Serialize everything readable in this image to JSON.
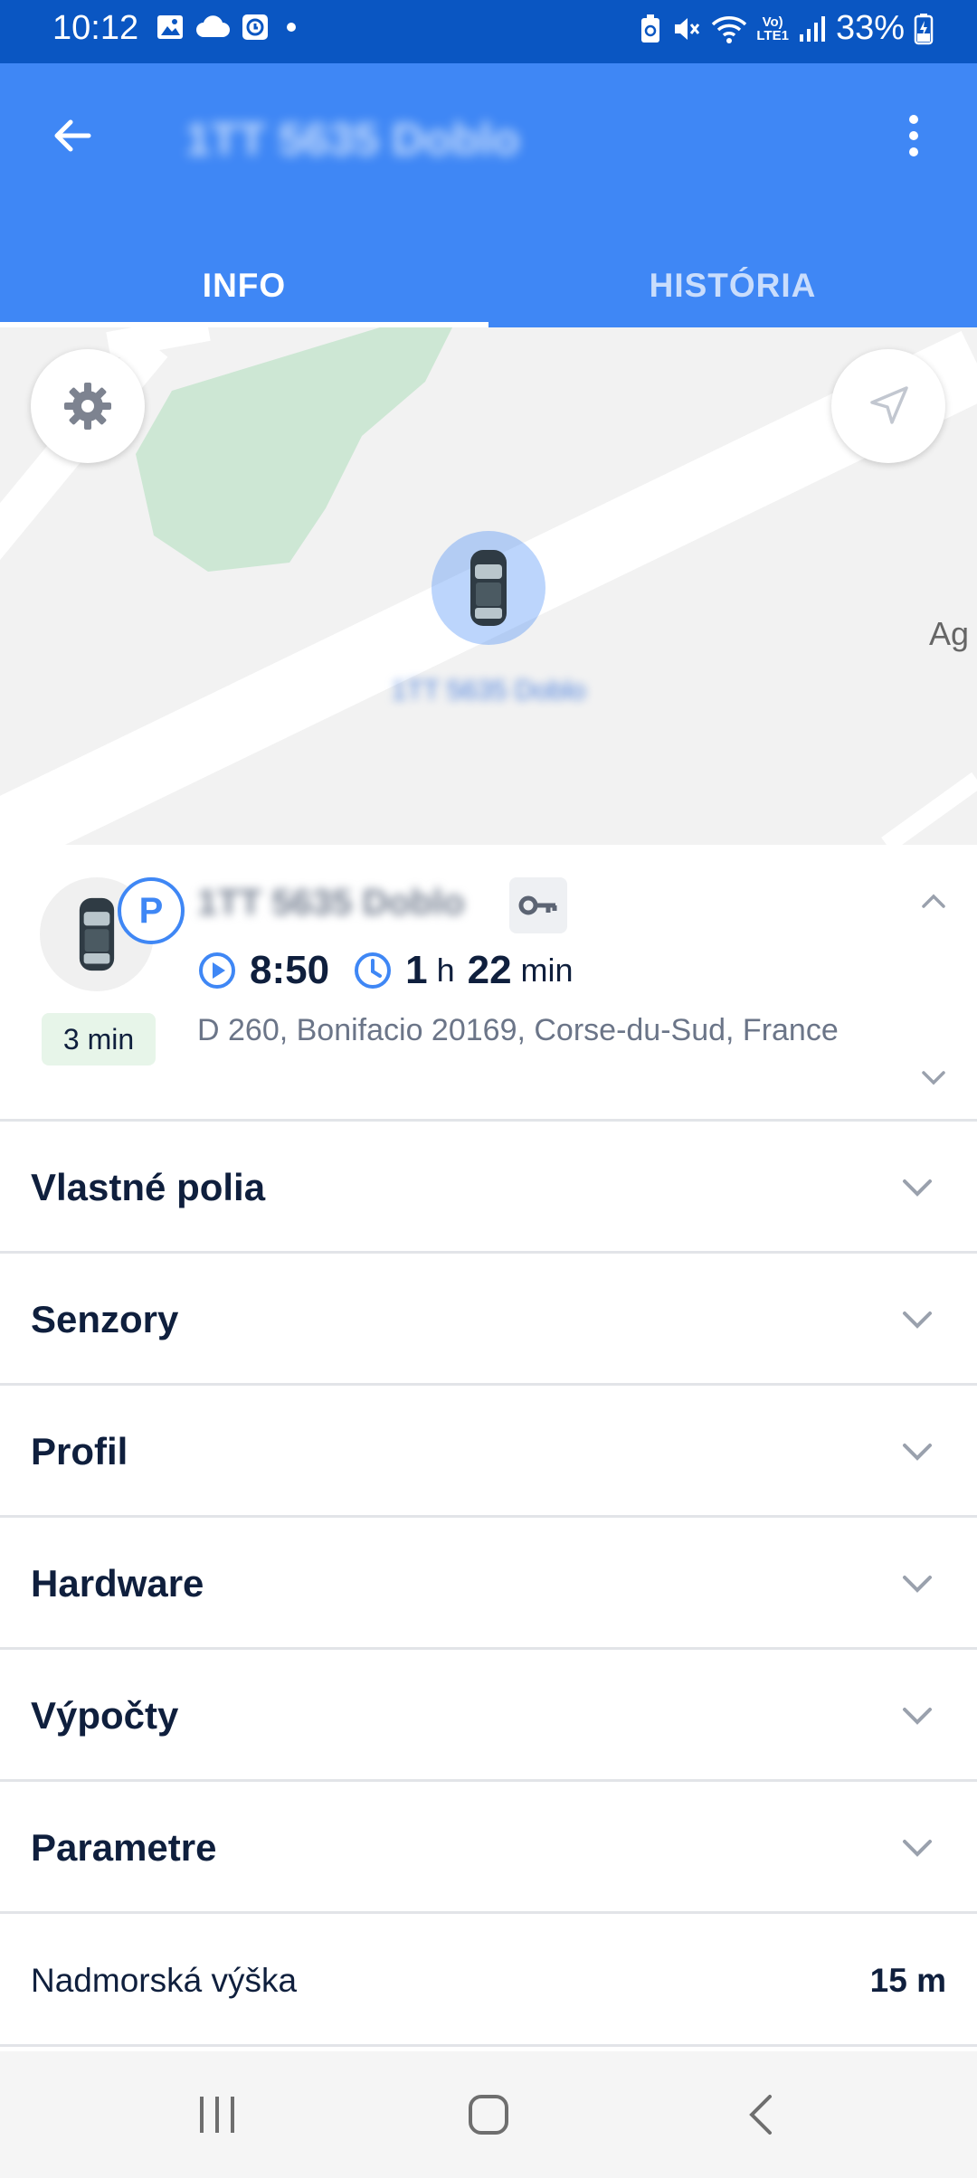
{
  "status_bar": {
    "time": "10:12",
    "lte_top": "Vo)",
    "lte_bottom": "LTE1",
    "battery": "33%",
    "icons": [
      "image-icon",
      "cloud-icon",
      "clock-app-icon",
      "dot-icon",
      "battery-saver-icon",
      "mute-icon",
      "wifi-icon",
      "signal-icon",
      "battery-icon"
    ]
  },
  "app_bar": {
    "title": "1TT 5635 Doblo",
    "tabs": [
      {
        "label": "INFO",
        "selected": true
      },
      {
        "label": "HISTÓRIA",
        "selected": false
      }
    ]
  },
  "map": {
    "vehicle_label": "1TT 5635 Doblo",
    "poi_fragment": "Ag"
  },
  "vehicle": {
    "name": "1TT 5635 Doblo",
    "state_badge": "P",
    "time_badge": "3 min",
    "start_time": "8:50",
    "duration_hours": "1",
    "duration_h_unit": "h",
    "duration_minutes": "22",
    "duration_min_unit": "min",
    "address": "D 260, Bonifacio 20169, Corse-du-Sud, France"
  },
  "sections": [
    {
      "label": "Vlastné polia"
    },
    {
      "label": "Senzory"
    },
    {
      "label": "Profil"
    },
    {
      "label": "Hardware"
    },
    {
      "label": "Výpočty"
    },
    {
      "label": "Parametre"
    }
  ],
  "parameters": [
    {
      "key": "Nadmorská výška",
      "value": "15 m"
    }
  ],
  "colors": {
    "status_bar": "#0a56c2",
    "app_bar": "#3f87f5",
    "text_dark": "#0f1f3d",
    "text_muted": "#6b7588",
    "park_green_bg": "#e7f5e9"
  }
}
